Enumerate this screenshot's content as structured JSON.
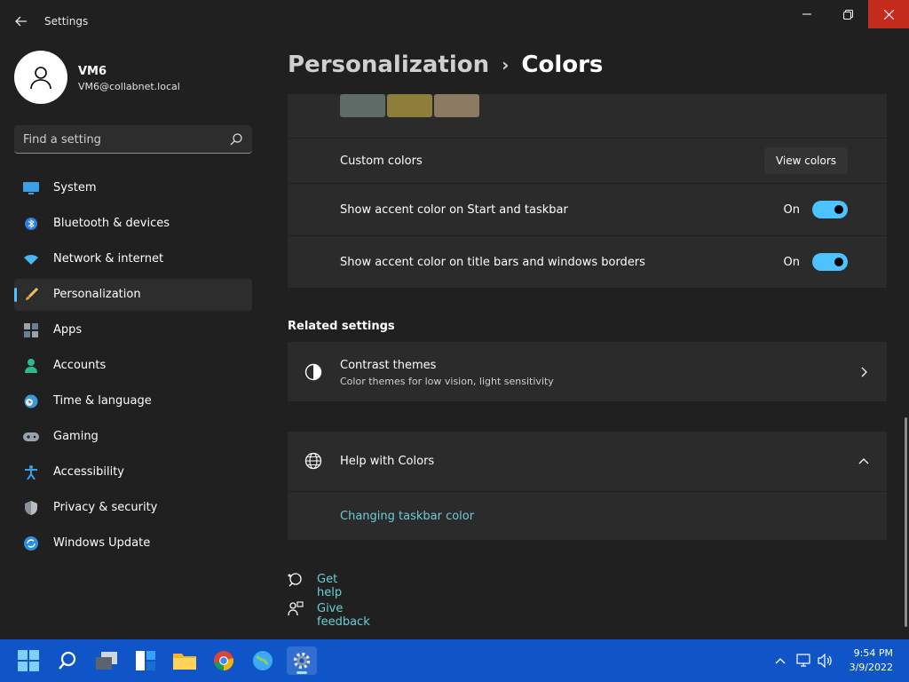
{
  "window": {
    "title": "Settings"
  },
  "profile": {
    "name": "VM6",
    "email": "VM6@collabnet.local"
  },
  "search": {
    "placeholder": "Find a setting"
  },
  "sidebar": {
    "items": [
      {
        "label": "System",
        "icon": "monitor-icon"
      },
      {
        "label": "Bluetooth & devices",
        "icon": "bluetooth-icon"
      },
      {
        "label": "Network & internet",
        "icon": "wifi-icon"
      },
      {
        "label": "Personalization",
        "icon": "brush-icon",
        "active": true
      },
      {
        "label": "Apps",
        "icon": "apps-icon"
      },
      {
        "label": "Accounts",
        "icon": "person-icon"
      },
      {
        "label": "Time & language",
        "icon": "clock-globe-icon"
      },
      {
        "label": "Gaming",
        "icon": "gamepad-icon"
      },
      {
        "label": "Accessibility",
        "icon": "accessibility-icon"
      },
      {
        "label": "Privacy & security",
        "icon": "shield-icon"
      },
      {
        "label": "Windows Update",
        "icon": "update-icon"
      }
    ]
  },
  "breadcrumb": {
    "parent": "Personalization",
    "separator": "›",
    "current": "Colors"
  },
  "colors": {
    "swatches": [
      "#5f6b67",
      "#8e7e3c",
      "#8d7a62"
    ],
    "accent": "#4cc2ff",
    "link": "#6ccdd8",
    "close": "#c42b1c",
    "taskbar": "#0f55c7"
  },
  "settings": {
    "custom_colors": {
      "label": "Custom colors",
      "button": "View colors"
    },
    "accent_start": {
      "label": "Show accent color on Start and taskbar",
      "state": "On"
    },
    "accent_title": {
      "label": "Show accent color on title bars and windows borders",
      "state": "On"
    }
  },
  "related": {
    "title": "Related settings",
    "contrast": {
      "title": "Contrast themes",
      "subtitle": "Color themes for low vision, light sensitivity"
    }
  },
  "help": {
    "title": "Help with Colors",
    "link": "Changing taskbar color"
  },
  "footer": {
    "get_help": "Get help",
    "give_feedback": "Give feedback"
  },
  "clock": {
    "time": "9:54 PM",
    "date": "3/9/2022"
  }
}
